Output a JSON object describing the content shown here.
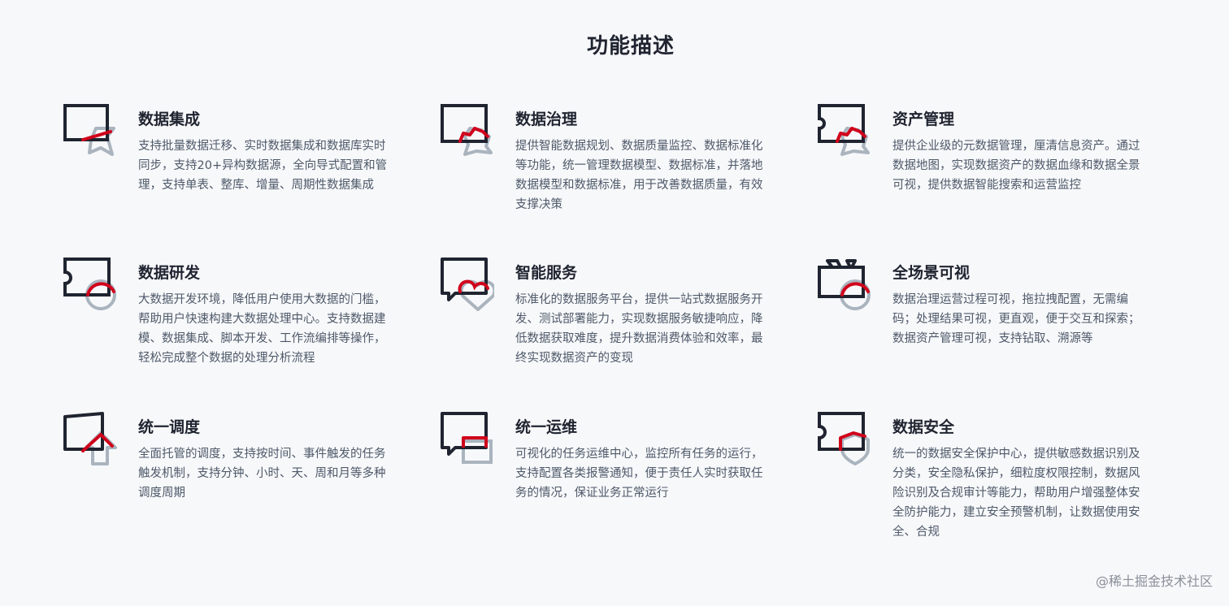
{
  "section": {
    "title": "功能描述"
  },
  "features": [
    {
      "title": "数据集成",
      "description": "支持批量数据迁移、实时数据集成和数据库实时同步，支持20+异构数据源，全向导式配置和管理，支持单表、整库、增量、周期性数据集成"
    },
    {
      "title": "数据治理",
      "description": "提供智能数据规划、数据质量监控、数据标准化等功能，统一管理数据模型、数据标准，并落地数据模型和数据标准，用于改善数据质量，有效支撑决策"
    },
    {
      "title": "资产管理",
      "description": "提供企业级的元数据管理，厘清信息资产。通过数据地图，实现数据资产的数据血缘和数据全景可视，提供数据智能搜索和运营监控"
    },
    {
      "title": "数据研发",
      "description": "大数据开发环境，降低用户使用大数据的门槛，帮助用户快速构建大数据处理中心。支持数据建模、数据集成、脚本开发、工作流编排等操作，轻松完成整个数据的处理分析流程"
    },
    {
      "title": "智能服务",
      "description": "标准化的数据服务平台，提供一站式数据服务开发、测试部署能力，实现数据服务敏捷响应，降低数据获取难度，提升数据消费体验和效率，最终实现数据资产的变现"
    },
    {
      "title": "全场景可视",
      "description": "数据治理运营过程可视，拖拉拽配置，无需编码；处理结果可视，更直观，便于交互和探索；数据资产管理可视，支持钻取、溯源等"
    },
    {
      "title": "统一调度",
      "description": "全面托管的调度，支持按时间、事件触发的任务触发机制，支持分钟、小时、天、周和月等多种调度周期"
    },
    {
      "title": "统一运维",
      "description": "可视化的任务运维中心，监控所有任务的运行，支持配置各类报警通知，便于责任人实时获取任务的情况，保证业务正常运行"
    },
    {
      "title": "数据安全",
      "description": "统一的数据安全保护中心，提供敏感数据识别及分类，安全隐私保护，细粒度权限控制，数据风险识别及合规审计等能力，帮助用户增强整体安全防护能力，建立安全预警机制，让数据使用安全、合规"
    }
  ],
  "icons": [
    "data-integration-icon",
    "data-governance-icon",
    "asset-management-icon",
    "data-development-icon",
    "smart-service-icon",
    "full-scene-visual-icon",
    "unified-scheduling-icon",
    "unified-ops-icon",
    "data-security-icon"
  ],
  "colors": {
    "background": "#f7f8fa",
    "title": "#1f2430",
    "body_text": "#4e5969",
    "icon_dark": "#1f2430",
    "icon_accent": "#d0021b",
    "icon_gray": "#aab4be"
  },
  "watermark": "@稀土掘金技术社区"
}
